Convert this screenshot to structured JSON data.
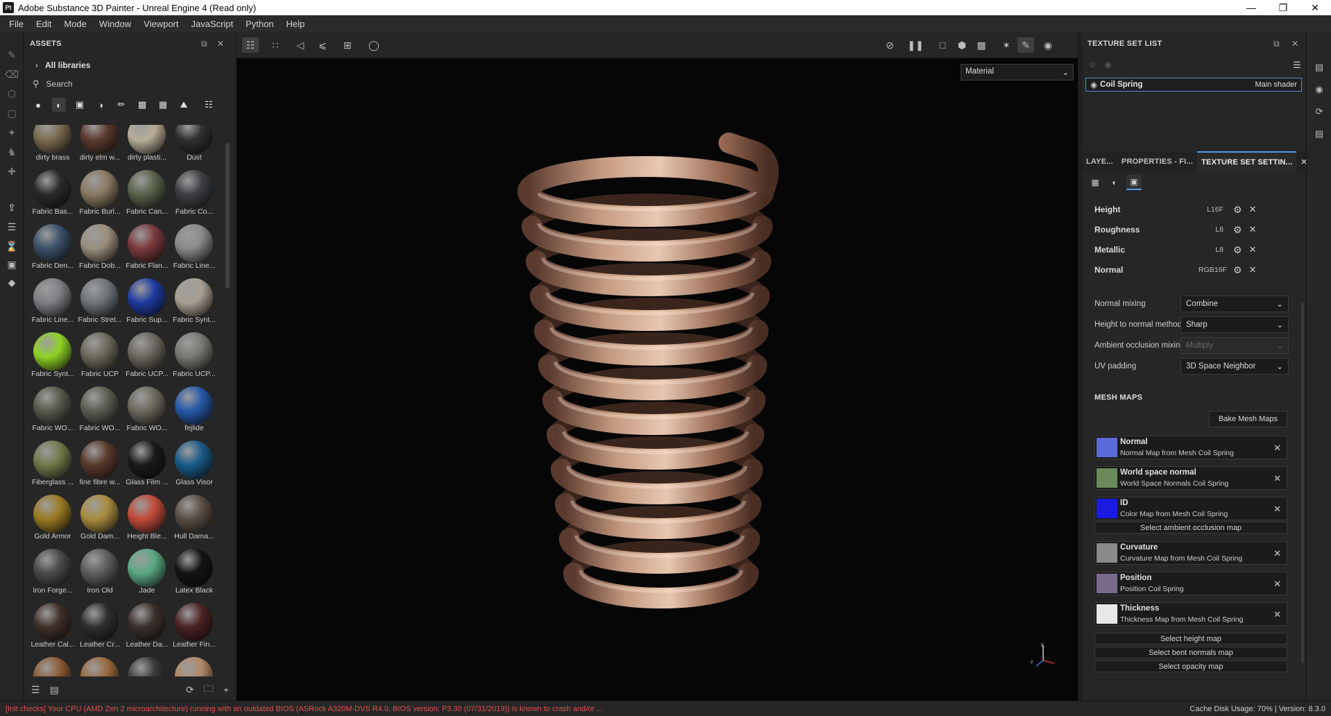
{
  "window": {
    "title": "Adobe Substance 3D Painter - Unreal Engine 4 (Read only)",
    "logo": "Pt"
  },
  "menu": [
    "File",
    "Edit",
    "Mode",
    "Window",
    "Viewport",
    "JavaScript",
    "Python",
    "Help"
  ],
  "assets": {
    "title": "ASSETS",
    "library": "All libraries",
    "search_placeholder": "Search",
    "items": [
      {
        "label": "dirty brass",
        "color": "#7a6a50"
      },
      {
        "label": "dirty elm w...",
        "color": "#5a3a2e"
      },
      {
        "label": "dirty plasti...",
        "color": "#b7ad98"
      },
      {
        "label": "Dust",
        "color": "#2f2f2f"
      },
      {
        "label": "Fabric Bas...",
        "color": "#2a2a2a"
      },
      {
        "label": "Fabric Burl...",
        "color": "#8a7a62"
      },
      {
        "label": "Fabric Can...",
        "color": "#59624a"
      },
      {
        "label": "Fabric Co...",
        "color": "#3d4043"
      },
      {
        "label": "Fabric Den...",
        "color": "#3b5068"
      },
      {
        "label": "Fabric Dob...",
        "color": "#9a8e7c"
      },
      {
        "label": "Fabric Flan...",
        "color": "#7a3a3c"
      },
      {
        "label": "Fabric Line...",
        "color": "#888a8c"
      },
      {
        "label": "Fabric Line...",
        "color": "#7d7f82"
      },
      {
        "label": "Fabric Stret...",
        "color": "#6f757a"
      },
      {
        "label": "Fabric Sup...",
        "color": "#1f3aa0"
      },
      {
        "label": "Fabric Synt...",
        "color": "#a89f92"
      },
      {
        "label": "Fabric Synt...",
        "color": "#8fd326"
      },
      {
        "label": "Fabric UCP",
        "color": "#6c6a5c"
      },
      {
        "label": "Fabric UCP...",
        "color": "#6a685e"
      },
      {
        "label": "Fabric UCP...",
        "color": "#7a7872"
      },
      {
        "label": "Fabric WO...",
        "color": "#575b4c"
      },
      {
        "label": "Fabric WO...",
        "color": "#5c5e52"
      },
      {
        "label": "Fabric WO...",
        "color": "#6d6a5e"
      },
      {
        "label": "fejlide",
        "color": "#2558a8"
      },
      {
        "label": "Fiberglass ...",
        "color": "#6f7a4a"
      },
      {
        "label": "fine fibre w...",
        "color": "#5a3a2c"
      },
      {
        "label": "Glass Film ...",
        "color": "#1a1a1a"
      },
      {
        "label": "Glass Visor",
        "color": "#1a5a88"
      },
      {
        "label": "Gold Armor",
        "color": "#9a7a22"
      },
      {
        "label": "Gold Dam...",
        "color": "#a88c3e"
      },
      {
        "label": "Height Ble...",
        "color": "#c04a3a"
      },
      {
        "label": "Hull Dama...",
        "color": "#5a4e44"
      },
      {
        "label": "Iron Forge...",
        "color": "#4a4a4c"
      },
      {
        "label": "Iron Old",
        "color": "#5e5e60"
      },
      {
        "label": "Jade",
        "color": "#5aa884"
      },
      {
        "label": "Latex Black",
        "color": "#141414"
      },
      {
        "label": "Leather Cal...",
        "color": "#3e3028"
      },
      {
        "label": "Leather Cr...",
        "color": "#2e2e30"
      },
      {
        "label": "Leather Da...",
        "color": "#3a302a"
      },
      {
        "label": "Leather Fin...",
        "color": "#4a2224"
      },
      {
        "label": "",
        "color": "#8a5a34"
      },
      {
        "label": "",
        "color": "#9a6a3e"
      },
      {
        "label": "",
        "color": "#3a3a3c"
      },
      {
        "label": "",
        "color": "#b08868"
      }
    ]
  },
  "viewport": {
    "material_mode": "Material"
  },
  "texture_set_list": {
    "title": "TEXTURE SET LIST",
    "set_name": "Coil Spring",
    "shader": "Main shader"
  },
  "tabs": [
    "LAYE...",
    "PROPERTIES - FI...",
    "TEXTURE SET SETTIN..."
  ],
  "channels": [
    {
      "name": "Height",
      "format": "L16F"
    },
    {
      "name": "Roughness",
      "format": "L8"
    },
    {
      "name": "Metallic",
      "format": "L8"
    },
    {
      "name": "Normal",
      "format": "RGB16F"
    }
  ],
  "properties": [
    {
      "label": "Normal mixing",
      "value": "Combine",
      "disabled": false
    },
    {
      "label": "Height to normal method",
      "value": "Sharp",
      "disabled": false
    },
    {
      "label": "Ambient occlusion mixing",
      "value": "Multiply",
      "disabled": true
    },
    {
      "label": "UV padding",
      "value": "3D Space Neighbor",
      "disabled": false
    }
  ],
  "mesh_maps": {
    "title": "MESH MAPS",
    "bake_button": "Bake Mesh Maps",
    "maps": [
      {
        "title": "Normal",
        "subtitle": "Normal Map from Mesh Coil Spring",
        "color": "#5a6ad8"
      },
      {
        "title": "World space normal",
        "subtitle": "World Space Normals Coil Spring",
        "color": "#6a8a5a"
      },
      {
        "title": "ID",
        "subtitle": "Color Map from Mesh Coil Spring",
        "color": "#1a1ae0"
      },
      {
        "title": "Curvature",
        "subtitle": "Curvature Map from Mesh Coil Spring",
        "color": "#8a8a8a"
      },
      {
        "title": "Position",
        "subtitle": "Position Coil Spring",
        "color": "#7a6a8a"
      },
      {
        "title": "Thickness",
        "subtitle": "Thickness Map from Mesh Coil Spring",
        "color": "#e8e8e8"
      }
    ],
    "select_ao": "Select ambient occlusion map",
    "select_height": "Select height map",
    "select_bent": "Select bent normals map",
    "select_opacity": "Select opacity map"
  },
  "status": {
    "error": "[Init checks] Your CPU (AMD Zen 2 microarchitecture) running with an outdated BIOS (ASRock A320M-DVS R4.0, BIOS version: P3.30 (07/31/2019)) is known to crash and/or ...",
    "right": "Cache Disk Usage:   70% | Version: 8.3.0"
  }
}
